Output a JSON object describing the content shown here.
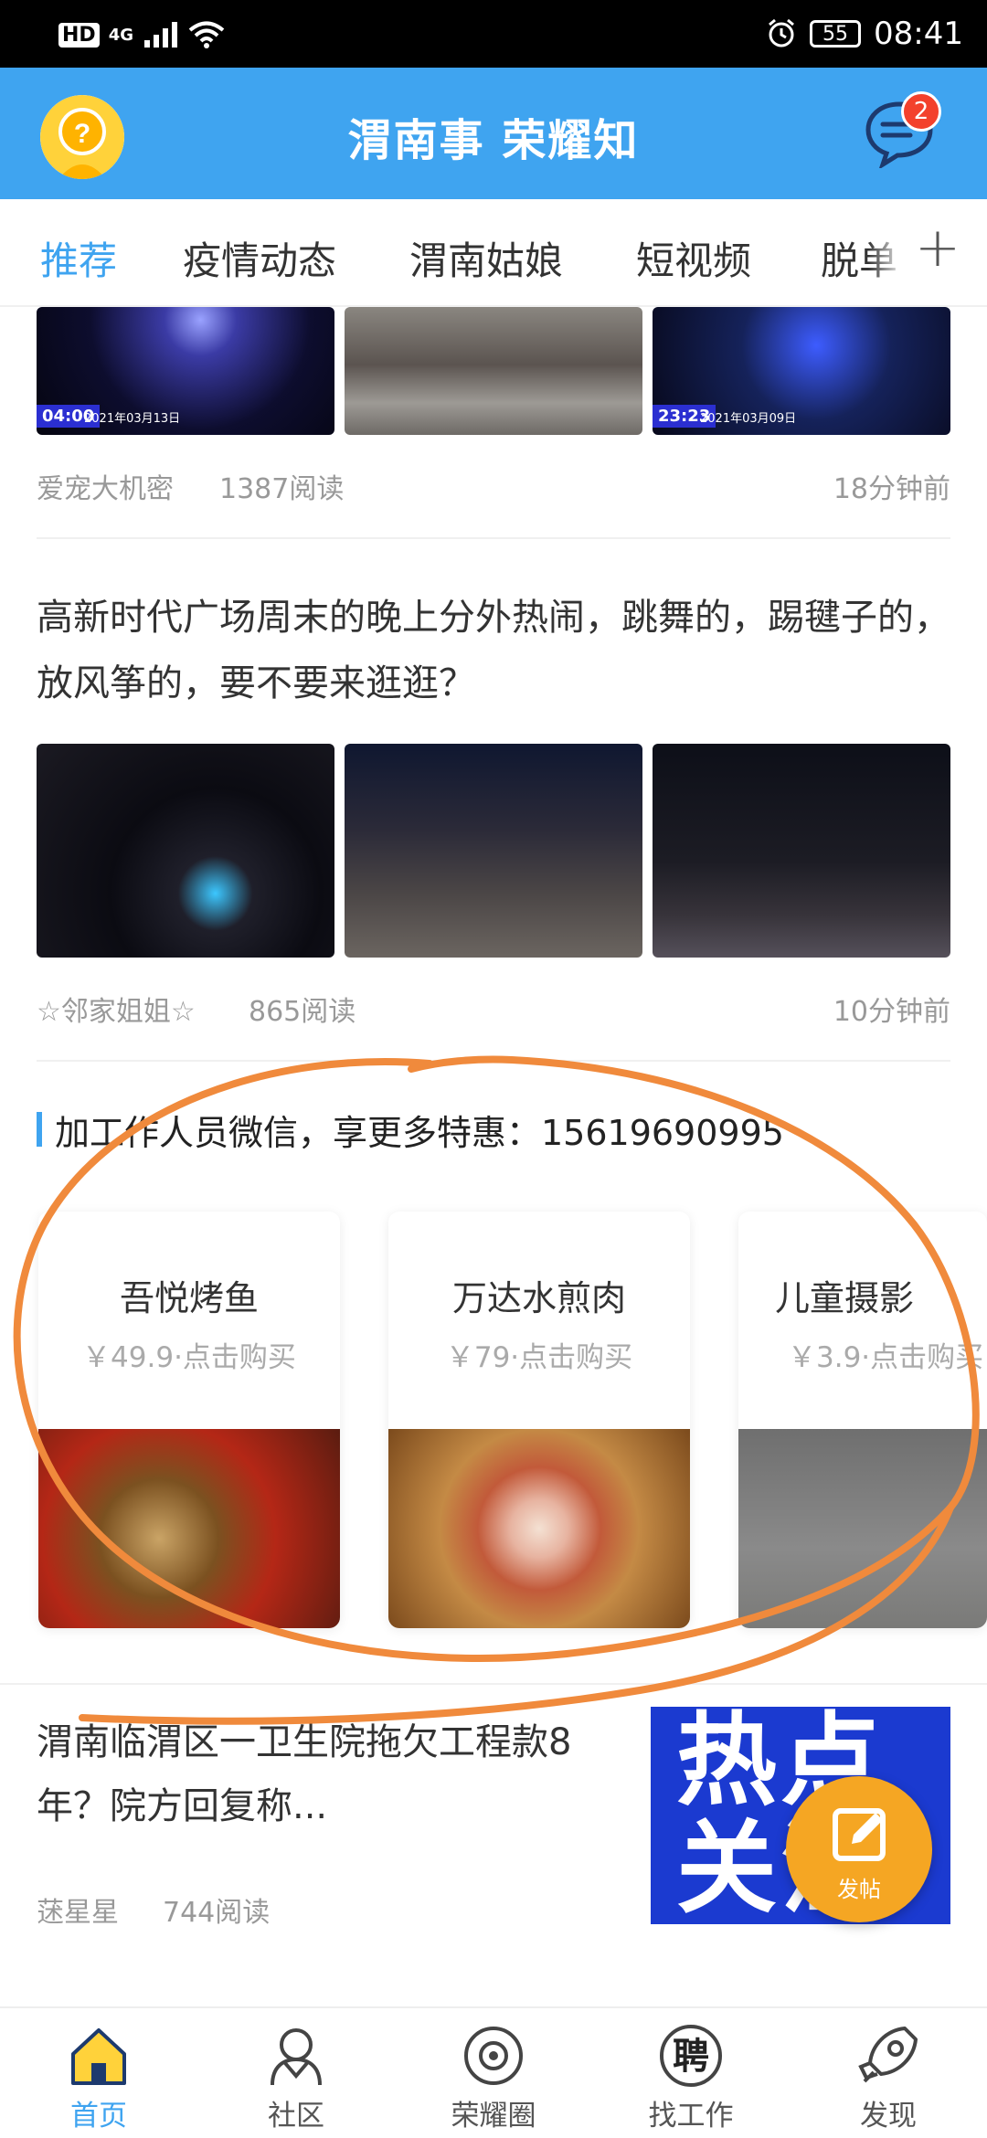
{
  "status_bar": {
    "hd": "HD",
    "network": "4G",
    "battery": "55",
    "time": "08:41"
  },
  "header": {
    "title": "渭南事  荣耀知",
    "message_badge": "2"
  },
  "tabs": {
    "items": [
      "推荐",
      "疫情动态",
      "渭南姑娘",
      "短视频",
      "脱单"
    ],
    "active": "推荐"
  },
  "feed": {
    "post1": {
      "images": [
        {
          "stamp": "04:00",
          "date": "2021年03月13日"
        },
        {
          "stamp": "",
          "date": ""
        },
        {
          "stamp": "23:23",
          "date": "2021年03月09日"
        }
      ],
      "author": "爱宠大机密",
      "reads": "1387阅读",
      "time": "18分钟前"
    },
    "post2": {
      "title": "高新时代广场周末的晚上分外热闹，跳舞的，踢毽子的，放风筝的，要不要来逛逛？",
      "author": "☆邻家姐姐☆",
      "reads": "865阅读",
      "time": "10分钟前"
    },
    "promo": {
      "heading": "加工作人员微信，享更多特惠：15619690995",
      "cards": [
        {
          "name": "吾悦烤鱼",
          "price": "￥49.9·点击购买"
        },
        {
          "name": "万达水煎肉",
          "price": "￥79·点击购买"
        },
        {
          "name": "儿童摄影",
          "price": "￥3.9·点击购买"
        }
      ]
    },
    "post3": {
      "title": "渭南临渭区一卫生院拖欠工程款8年？院方回复称...",
      "image_text": "热点关注",
      "author": "蒁星星",
      "reads": "744阅读"
    }
  },
  "fab": {
    "label": "发帖",
    "color": "#f5a623"
  },
  "bottom_nav": {
    "items": [
      {
        "label": "首页",
        "icon": "home-icon"
      },
      {
        "label": "社区",
        "icon": "community-icon"
      },
      {
        "label": "荣耀圈",
        "icon": "planet-icon"
      },
      {
        "label": "找工作",
        "icon": "recruit-icon"
      },
      {
        "label": "发现",
        "icon": "rocket-icon"
      }
    ],
    "active": "首页"
  },
  "colors": {
    "accent": "#3fa4f0",
    "annotation": "#f08a3c"
  }
}
